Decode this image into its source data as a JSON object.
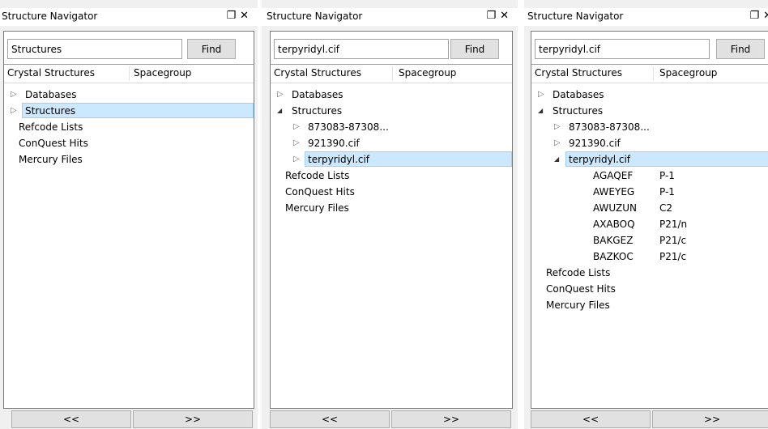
{
  "panels": [
    {
      "title": "Structure Navigator",
      "search_value": "Structures",
      "find_label": "Find",
      "columns": [
        "Crystal Structures",
        "Spacegroup"
      ],
      "tree": [
        {
          "label": "Databases",
          "arrow": "closed",
          "level": 0
        },
        {
          "label": "Structures",
          "arrow": "closed",
          "level": 0,
          "selected": true
        },
        {
          "label": "Refcode Lists",
          "level": 0
        },
        {
          "label": "ConQuest Hits",
          "level": 0
        },
        {
          "label": "Mercury Files",
          "level": 0
        }
      ],
      "prev_label": "<<",
      "next_label": ">>"
    },
    {
      "title": "Structure Navigator",
      "search_value": "terpyridyl.cif",
      "find_label": "Find",
      "columns": [
        "Crystal Structures",
        "Spacegroup"
      ],
      "tree": [
        {
          "label": "Databases",
          "arrow": "closed",
          "level": 0
        },
        {
          "label": "Structures",
          "arrow": "open",
          "level": 0
        },
        {
          "label": "873083-87308...",
          "arrow": "closed",
          "level": 1
        },
        {
          "label": "921390.cif",
          "arrow": "closed",
          "level": 1
        },
        {
          "label": "terpyridyl.cif",
          "arrow": "closed",
          "level": 1,
          "selected": true
        },
        {
          "label": "Refcode Lists",
          "level": 0
        },
        {
          "label": "ConQuest Hits",
          "level": 0
        },
        {
          "label": "Mercury Files",
          "level": 0
        }
      ],
      "prev_label": "<<",
      "next_label": ">>"
    },
    {
      "title": "Structure Navigator",
      "search_value": "terpyridyl.cif",
      "find_label": "Find",
      "columns": [
        "Crystal Structures",
        "Spacegroup"
      ],
      "tree": [
        {
          "label": "Databases",
          "arrow": "closed",
          "level": 0
        },
        {
          "label": "Structures",
          "arrow": "open",
          "level": 0
        },
        {
          "label": "873083-87308...",
          "arrow": "closed",
          "level": 1
        },
        {
          "label": "921390.cif",
          "arrow": "closed",
          "level": 1
        },
        {
          "label": "terpyridyl.cif",
          "arrow": "open",
          "level": 1,
          "selected": true
        },
        {
          "label": "AGAQEF",
          "level": 2,
          "spacegroup": "P-1"
        },
        {
          "label": "AWEYEG",
          "level": 2,
          "spacegroup": "P-1"
        },
        {
          "label": "AWUZUN",
          "level": 2,
          "spacegroup": "C2"
        },
        {
          "label": "AXABOQ",
          "level": 2,
          "spacegroup": "P21/n"
        },
        {
          "label": "BAKGEZ",
          "level": 2,
          "spacegroup": "P21/c"
        },
        {
          "label": "BAZKOC",
          "level": 2,
          "spacegroup": "P21/c"
        },
        {
          "label": "Refcode Lists",
          "level": 0
        },
        {
          "label": "ConQuest Hits",
          "level": 0
        },
        {
          "label": "Mercury Files",
          "level": 0
        }
      ],
      "prev_label": "<<",
      "next_label": ">>"
    }
  ],
  "icons": {
    "float": "float-window-icon",
    "close": "close-icon",
    "collapsed": "collapsed-arrow-icon",
    "expanded": "expanded-arrow-icon"
  },
  "colors": {
    "selection_fill": "#cce8ff",
    "selection_border": "#99d1ff",
    "panel_bg": "#f0f0f0"
  }
}
